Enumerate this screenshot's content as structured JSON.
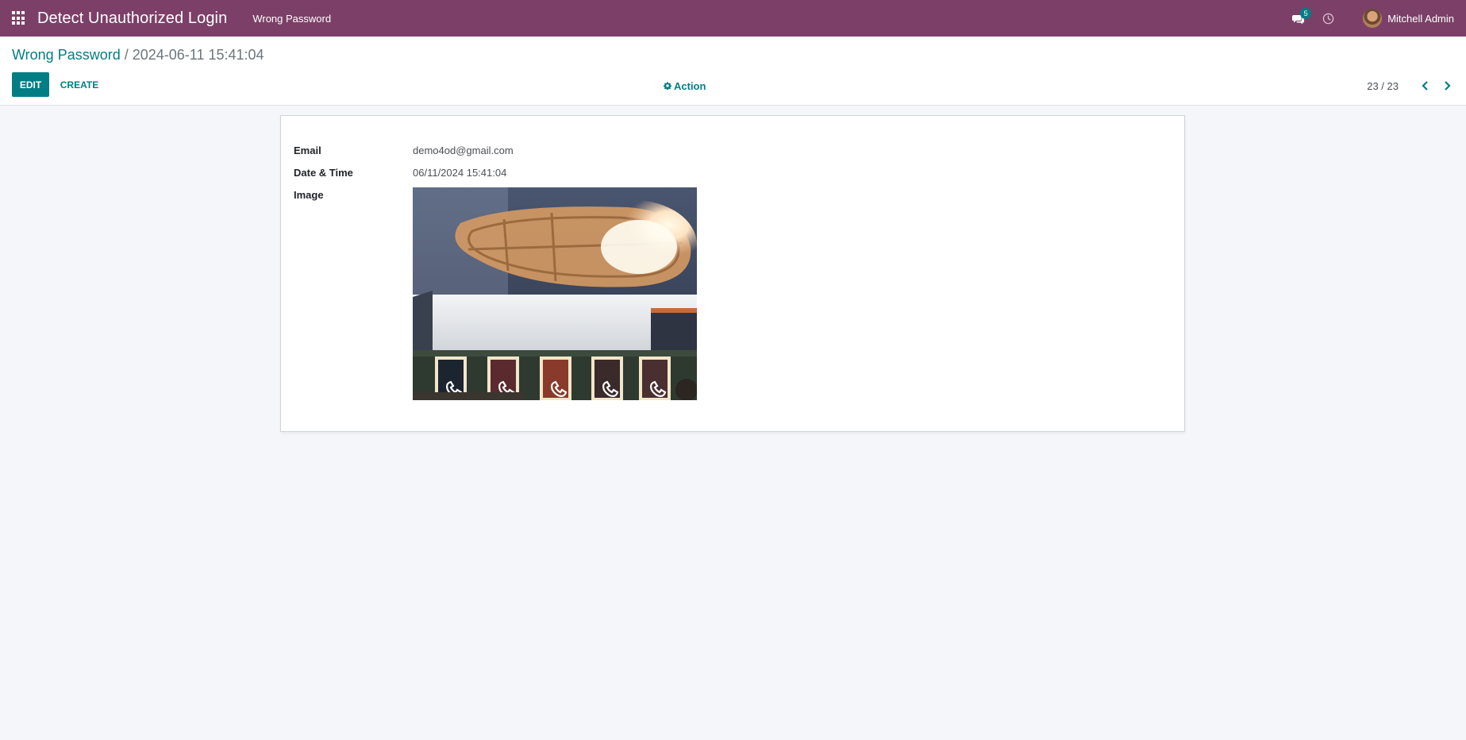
{
  "navbar": {
    "app_title": "Detect Unauthorized Login",
    "menu_item": "Wrong Password",
    "chat_count": "5",
    "user_name": "Mitchell Admin"
  },
  "breadcrumb": {
    "parent": "Wrong Password",
    "separator": " / ",
    "current": "2024-06-11 15:41:04"
  },
  "toolbar": {
    "edit_label": "EDIT",
    "create_label": "CREATE",
    "action_label": "Action"
  },
  "pager": {
    "value": "23 / 23"
  },
  "form": {
    "email_label": "Email",
    "email_value": "demo4od@gmail.com",
    "datetime_label": "Date & Time",
    "datetime_value": "06/11/2024 15:41:04",
    "image_label": "Image"
  },
  "colors": {
    "navbar": "#7c4068",
    "primary": "#017e84",
    "background": "#f5f6f9"
  }
}
